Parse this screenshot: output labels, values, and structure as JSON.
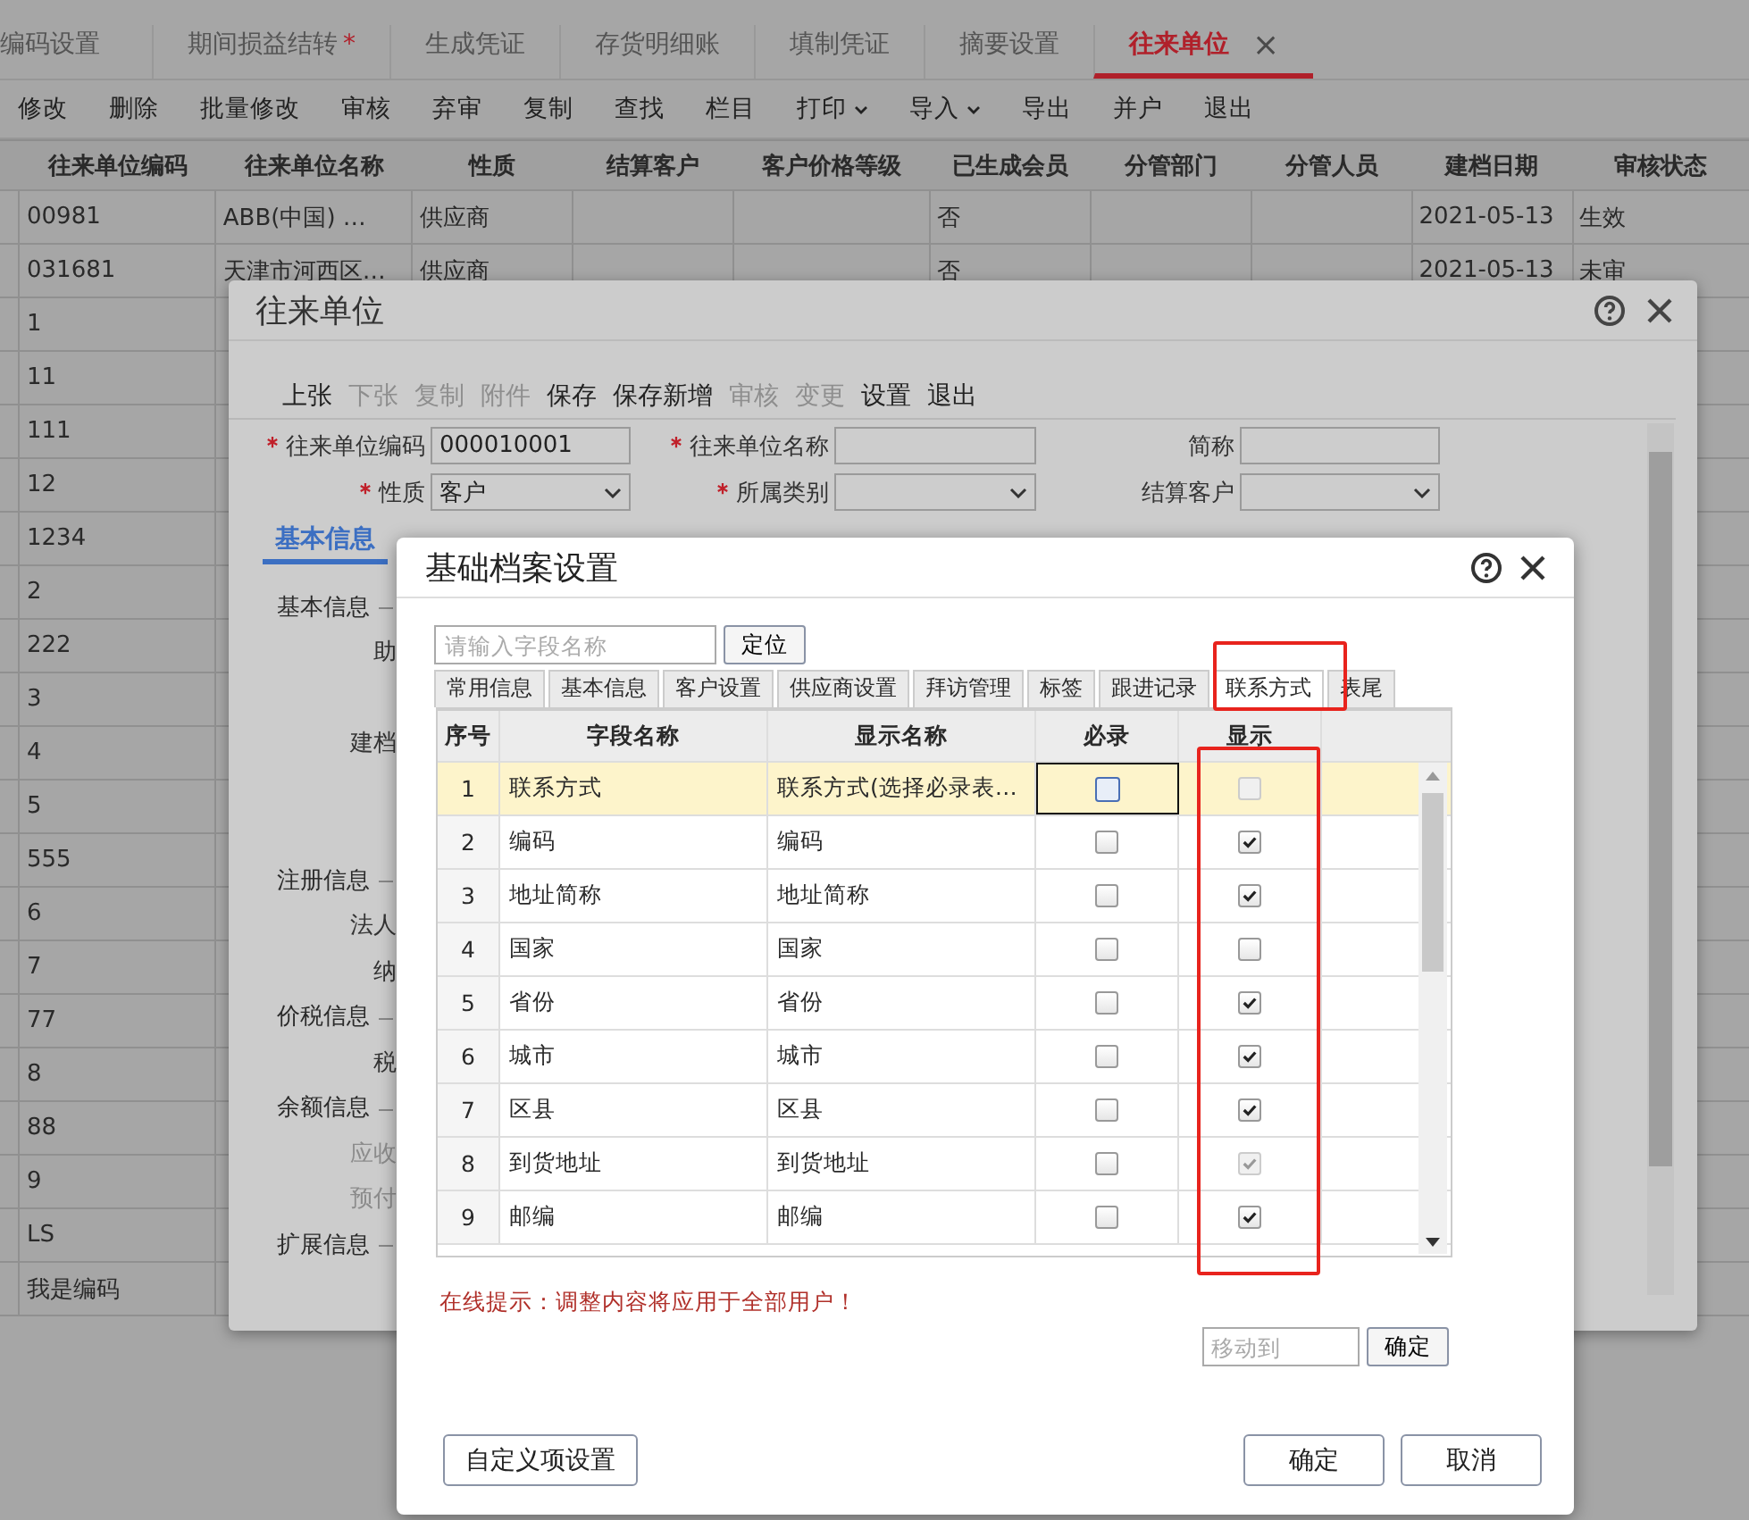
{
  "main_tabs": [
    {
      "label": "编码设置",
      "selected": false
    },
    {
      "label": "期间损益结转",
      "mark": "*",
      "selected": false
    },
    {
      "label": "生成凭证",
      "selected": false
    },
    {
      "label": "存货明细账",
      "selected": false
    },
    {
      "label": "填制凭证",
      "selected": false
    },
    {
      "label": "摘要设置",
      "selected": false
    },
    {
      "label": "往来单位",
      "selected": true,
      "close": "×"
    }
  ],
  "toolbar": [
    {
      "label": "修改",
      "caret": false
    },
    {
      "label": "删除",
      "caret": false
    },
    {
      "label": "批量修改",
      "caret": false
    },
    {
      "label": "审核",
      "caret": false
    },
    {
      "label": "弃审",
      "caret": false
    },
    {
      "label": "复制",
      "caret": false
    },
    {
      "label": "查找",
      "caret": false
    },
    {
      "label": "栏目",
      "caret": false
    },
    {
      "label": "打印",
      "caret": true
    },
    {
      "label": "导入",
      "caret": true
    },
    {
      "label": "导出",
      "caret": false
    },
    {
      "label": "并户",
      "caret": false
    },
    {
      "label": "退出",
      "caret": false
    }
  ],
  "table": {
    "columns": [
      "往来单位编码",
      "往来单位名称",
      "性质",
      "结算客户",
      "客户价格等级",
      "已生成会员",
      "分管部门",
      "分管人员",
      "建档日期",
      "审核状态"
    ],
    "rows": [
      {
        "code": "00981",
        "name": "ABB(中国) …",
        "nature": "供应商",
        "member": "否",
        "date": "2021-05-13",
        "status": "生效"
      },
      {
        "code": "031681",
        "name": "天津市河西区…",
        "nature": "供应商",
        "member": "否",
        "date": "2021-05-13",
        "status": "未审"
      },
      {
        "code": "1"
      },
      {
        "code": "11"
      },
      {
        "code": "111"
      },
      {
        "code": "12"
      },
      {
        "code": "1234"
      },
      {
        "code": "2"
      },
      {
        "code": "222"
      },
      {
        "code": "3"
      },
      {
        "code": "4"
      },
      {
        "code": "5"
      },
      {
        "code": "555"
      },
      {
        "code": "6"
      },
      {
        "code": "7"
      },
      {
        "code": "77"
      },
      {
        "code": "8"
      },
      {
        "code": "88"
      },
      {
        "code": "9"
      },
      {
        "code": "LS"
      },
      {
        "code": "我是编码"
      }
    ]
  },
  "unit_dialog": {
    "title": "往来单位",
    "toolbar": [
      {
        "label": "上张",
        "disabled": false
      },
      {
        "label": "下张",
        "disabled": true
      },
      {
        "label": "复制",
        "disabled": true
      },
      {
        "label": "附件",
        "disabled": true
      },
      {
        "label": "保存",
        "disabled": false
      },
      {
        "label": "保存新增",
        "disabled": false
      },
      {
        "label": "审核",
        "disabled": true
      },
      {
        "label": "变更",
        "disabled": true
      },
      {
        "label": "设置",
        "disabled": false
      },
      {
        "label": "退出",
        "disabled": false
      }
    ],
    "fields": [
      {
        "label": "往来单位编码",
        "required": true,
        "kind": "input",
        "value": "000010001"
      },
      {
        "label": "往来单位名称",
        "required": true,
        "kind": "input"
      },
      {
        "label": "简称",
        "required": false,
        "kind": "input"
      },
      {
        "label": "性质",
        "required": true,
        "kind": "select",
        "value": "客户"
      },
      {
        "label": "所属类别",
        "required": true,
        "kind": "select"
      },
      {
        "label": "结算客户",
        "required": false,
        "kind": "select"
      }
    ],
    "tab": {
      "label": "基本信息",
      "selected": true
    },
    "body": [
      {
        "kind": "section",
        "label": "基本信息"
      },
      {
        "kind": "field",
        "label": "助",
        "disabled": false
      },
      {
        "kind": "field",
        "label": "建档",
        "disabled": false
      },
      {
        "kind": "section",
        "label": "注册信息"
      },
      {
        "kind": "field",
        "label": "法人",
        "disabled": false
      },
      {
        "kind": "field",
        "label": "纳",
        "disabled": false
      },
      {
        "kind": "section",
        "label": "价税信息"
      },
      {
        "kind": "field",
        "label": "税",
        "disabled": false
      },
      {
        "kind": "section",
        "label": "余额信息"
      },
      {
        "kind": "field",
        "label": "应收",
        "disabled": true
      },
      {
        "kind": "field",
        "label": "预付",
        "disabled": true
      },
      {
        "kind": "section",
        "label": "扩展信息"
      }
    ]
  },
  "settings_dialog": {
    "title": "基础档案设置",
    "search": {
      "placeholder": "请输入字段名称"
    },
    "locate_button": "定位",
    "tabs": [
      {
        "label": "常用信息",
        "selected": false
      },
      {
        "label": "基本信息",
        "selected": false
      },
      {
        "label": "客户设置",
        "selected": false
      },
      {
        "label": "供应商设置",
        "selected": false
      },
      {
        "label": "拜访管理",
        "selected": false
      },
      {
        "label": "标签",
        "selected": false
      },
      {
        "label": "跟进记录",
        "selected": false
      },
      {
        "label": "联系方式",
        "selected": true
      },
      {
        "label": "表尾",
        "selected": false
      }
    ],
    "columns": [
      "序号",
      "字段名称",
      "显示名称",
      "必录",
      "显示"
    ],
    "rows": [
      {
        "no": "1",
        "field": "联系方式",
        "display": "联系方式(选择必录表…",
        "required": false,
        "shown": false,
        "shown_disabled": true,
        "selected": true
      },
      {
        "no": "2",
        "field": "编码",
        "display": "编码",
        "required": false,
        "shown": true,
        "shown_disabled": false,
        "selected": false
      },
      {
        "no": "3",
        "field": "地址简称",
        "display": "地址简称",
        "required": false,
        "shown": true,
        "shown_disabled": false,
        "selected": false
      },
      {
        "no": "4",
        "field": "国家",
        "display": "国家",
        "required": false,
        "shown": false,
        "shown_disabled": false,
        "selected": false
      },
      {
        "no": "5",
        "field": "省份",
        "display": "省份",
        "required": false,
        "shown": true,
        "shown_disabled": false,
        "selected": false
      },
      {
        "no": "6",
        "field": "城市",
        "display": "城市",
        "required": false,
        "shown": true,
        "shown_disabled": false,
        "selected": false
      },
      {
        "no": "7",
        "field": "区县",
        "display": "区县",
        "required": false,
        "shown": true,
        "shown_disabled": false,
        "selected": false
      },
      {
        "no": "8",
        "field": "到货地址",
        "display": "到货地址",
        "required": false,
        "shown": true,
        "shown_disabled": true,
        "selected": false
      },
      {
        "no": "9",
        "field": "邮编",
        "display": "邮编",
        "required": false,
        "shown": true,
        "shown_disabled": false,
        "selected": false
      }
    ],
    "hint": "在线提示：调整内容将应用于全部用户！",
    "move": {
      "placeholder": "移动到",
      "button": "确定"
    },
    "custom_button": "自定义项设置",
    "ok_button": "确定",
    "cancel_button": "取消"
  }
}
